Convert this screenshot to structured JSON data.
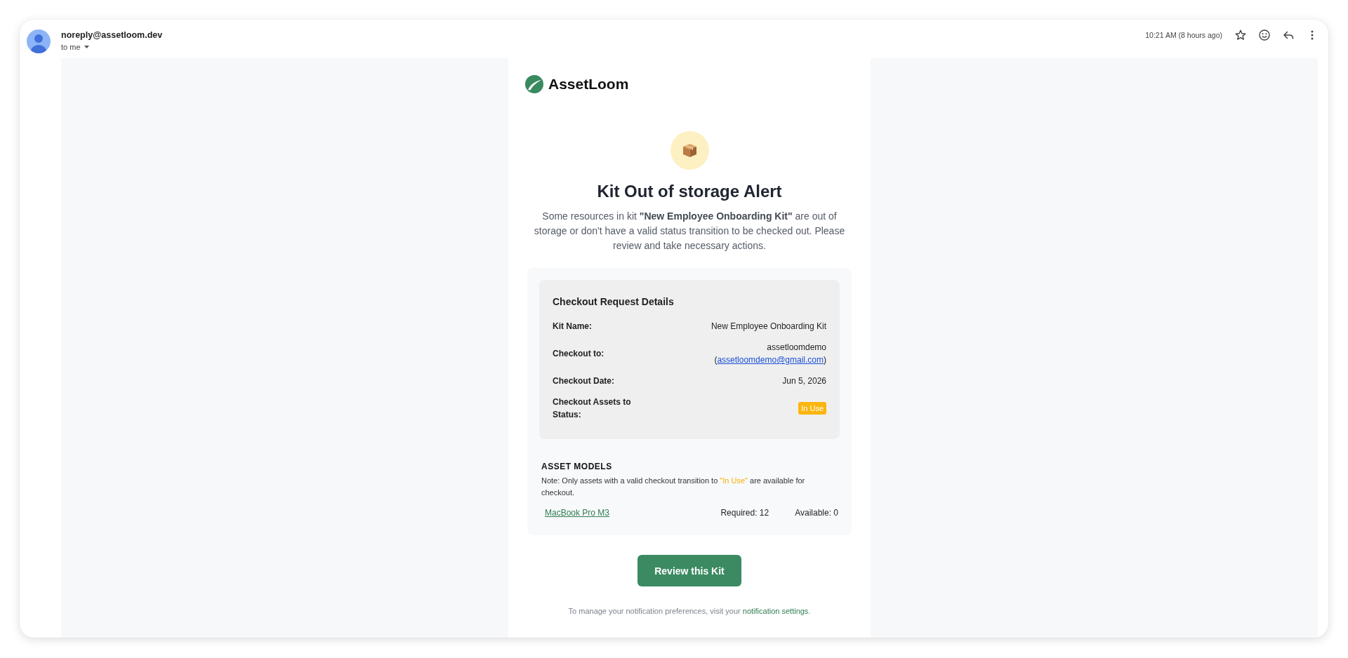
{
  "message_header": {
    "sender": "noreply@assetloom.dev",
    "recipient": "to me",
    "time": "10:21 AM (8 hours ago)"
  },
  "brand": {
    "name": "AssetLoom"
  },
  "alert": {
    "title": "Kit Out of storage Alert",
    "message": "Some resources in kit **\"New Employee Onboarding Kit\"** are out of storage or don't have a valid status transition to be checked out. Please review and take necessary actions."
  },
  "checkout_details": {
    "heading": "Checkout Request Details",
    "rows": [
      {
        "kind": "text",
        "label": "Kit Name:",
        "value": "New Employee Onboarding Kit"
      },
      {
        "kind": "contact",
        "label": "Checkout to:",
        "value": "assetloomdemo",
        "prefix": "(",
        "email": "assetloomdemo@gmail.com",
        "suffix": ")"
      },
      {
        "kind": "text",
        "label": "Checkout Date:",
        "value": "Jun 5, 2026"
      },
      {
        "kind": "badge",
        "label": "Checkout Assets to Status:",
        "value": "In Use"
      }
    ]
  },
  "asset_models": {
    "heading": "ASSET MODELS",
    "note": {
      "before": "Note: Only assets with a valid checkout transition to ",
      "status": "\"In Use\"",
      "after": " are available for checkout."
    },
    "models": [
      {
        "name": "MacBook Pro M3",
        "required": "Required: 12",
        "available": "Available: 0"
      }
    ]
  },
  "action_button": {
    "label": "Review this Kit"
  },
  "footer": {
    "text": "To manage your notification preferences, visit your ",
    "link": "notification settings",
    "end": "."
  }
}
